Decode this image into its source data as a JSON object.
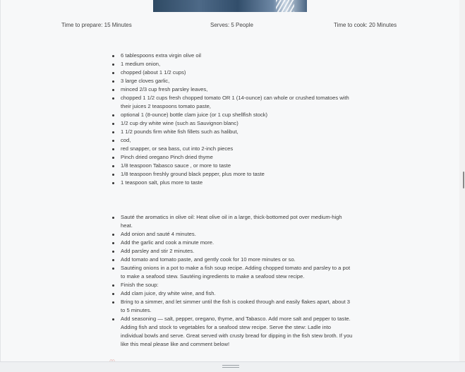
{
  "meta": {
    "prep": "Time to prepare: 15 Minutes",
    "serves": "Serves: 5 People",
    "cook": "Time to cook: 20 Minutes"
  },
  "ingredients": [
    "6 tablespoons extra virgin olive oil",
    "1 medium onion,",
    "chopped (about 1 1/2 cups)",
    "3 large cloves garlic,",
    "minced 2/3 cup fresh parsley leaves,",
    "chopped 1 1/2 cups fresh chopped tomato OR 1 (14-ounce) can whole or crushed tomatoes with their juices 2 teaspoons tomato paste,",
    "optional 1 (8-ounce) bottle clam juice (or 1 cup shellfish stock)",
    "1/2 cup dry white wine (such as Sauvignon blanc)",
    "1 1/2 pounds firm white fish fillets such as halibut,",
    "cod,",
    "red snapper, or sea bass, cut into 2-inch pieces",
    "Pinch dried oregano Pinch dried thyme",
    "1/8 teaspoon Tabasco sauce , or more to taste",
    "1/8 teaspoon freshly ground black pepper, plus more to taste",
    "1 teaspoon salt, plus more to taste"
  ],
  "steps": [
    "Sauté the aromatics in olive oil: Heat olive oil in a large, thick-bottomed pot over medium-high heat.",
    "Add onion and sauté 4 minutes.",
    "Add the garlic and cook a minute more.",
    "Add parsley and stir 2 minutes.",
    "Add tomato and tomato paste, and gently cook for 10 more minutes or so.",
    "Sautéing onions in a pot to make a fish soup recipe. Adding chopped tomato and parsley to a pot to make a seafood stew. Sautéing ingredients to make a seafood stew recipe.",
    "Finish the soup:",
    "Add clam juice, dry white wine, and fish.",
    "Bring to a simmer, and let simmer until the fish is cooked through and easily flakes apart, about 3 to 5 minutes.",
    "Add seasoning — salt, pepper, oregano, thyme, and Tabasco. Add more salt and pepper to taste. Adding fish and stock to vegetables for a seafood stew recipe. Serve the stew: Ladle into individual bowls and serve. Great served with crusty bread for dipping in the fish stew broth. If you like this meal please like and comment below!"
  ],
  "icons": {
    "heart": "heart-icon",
    "grip": "drag-handle-icon"
  },
  "colors": {
    "background": "#f7f8f9",
    "text": "#3d3d3d",
    "heart": "#c0392b"
  }
}
